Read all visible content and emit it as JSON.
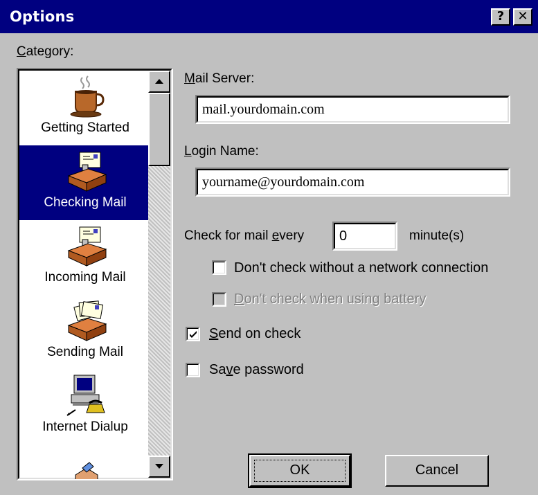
{
  "window": {
    "title": "Options",
    "help_button": "?",
    "close_button": "✕"
  },
  "category": {
    "label_accel": "C",
    "label_rest": "ategory:",
    "items": [
      {
        "label": "Getting Started",
        "icon": "coffee-cup-icon",
        "selected": false
      },
      {
        "label": "Checking Mail",
        "icon": "mailbox-tray-icon",
        "selected": true
      },
      {
        "label": "Incoming Mail",
        "icon": "mailbox-tray-icon",
        "selected": false
      },
      {
        "label": "Sending Mail",
        "icon": "outbox-tray-icon",
        "selected": false
      },
      {
        "label": "Internet Dialup",
        "icon": "computer-phone-icon",
        "selected": false
      },
      {
        "label": "",
        "icon": "partially-visible-icon",
        "selected": false
      }
    ]
  },
  "mail_server": {
    "label_accel": "M",
    "label_rest": "ail Server:",
    "value": "mail.yourdomain.com"
  },
  "login_name": {
    "label_accel": "L",
    "label_rest": "ogin Name:",
    "value": "yourname@yourdomain.com"
  },
  "check_every": {
    "label_pre": "Check for mail ",
    "label_accel": "e",
    "label_post": "very",
    "value": "0",
    "unit": "minute(s)"
  },
  "options": {
    "no_network": {
      "label": "Don't check without a network connection",
      "checked": false,
      "enabled": true
    },
    "battery": {
      "label_accel": "D",
      "label_rest": "on't check when using battery",
      "checked": false,
      "enabled": false
    },
    "send_on_check": {
      "label_accel": "S",
      "label_rest": "end on check",
      "checked": true,
      "enabled": true
    },
    "save_password": {
      "label_pre": "Sa",
      "label_accel": "v",
      "label_post": "e password",
      "checked": false,
      "enabled": true
    }
  },
  "buttons": {
    "ok": "OK",
    "cancel": "Cancel"
  },
  "colors": {
    "titlebar": "#000080",
    "face": "#c0c0c0",
    "selection": "#000080"
  }
}
